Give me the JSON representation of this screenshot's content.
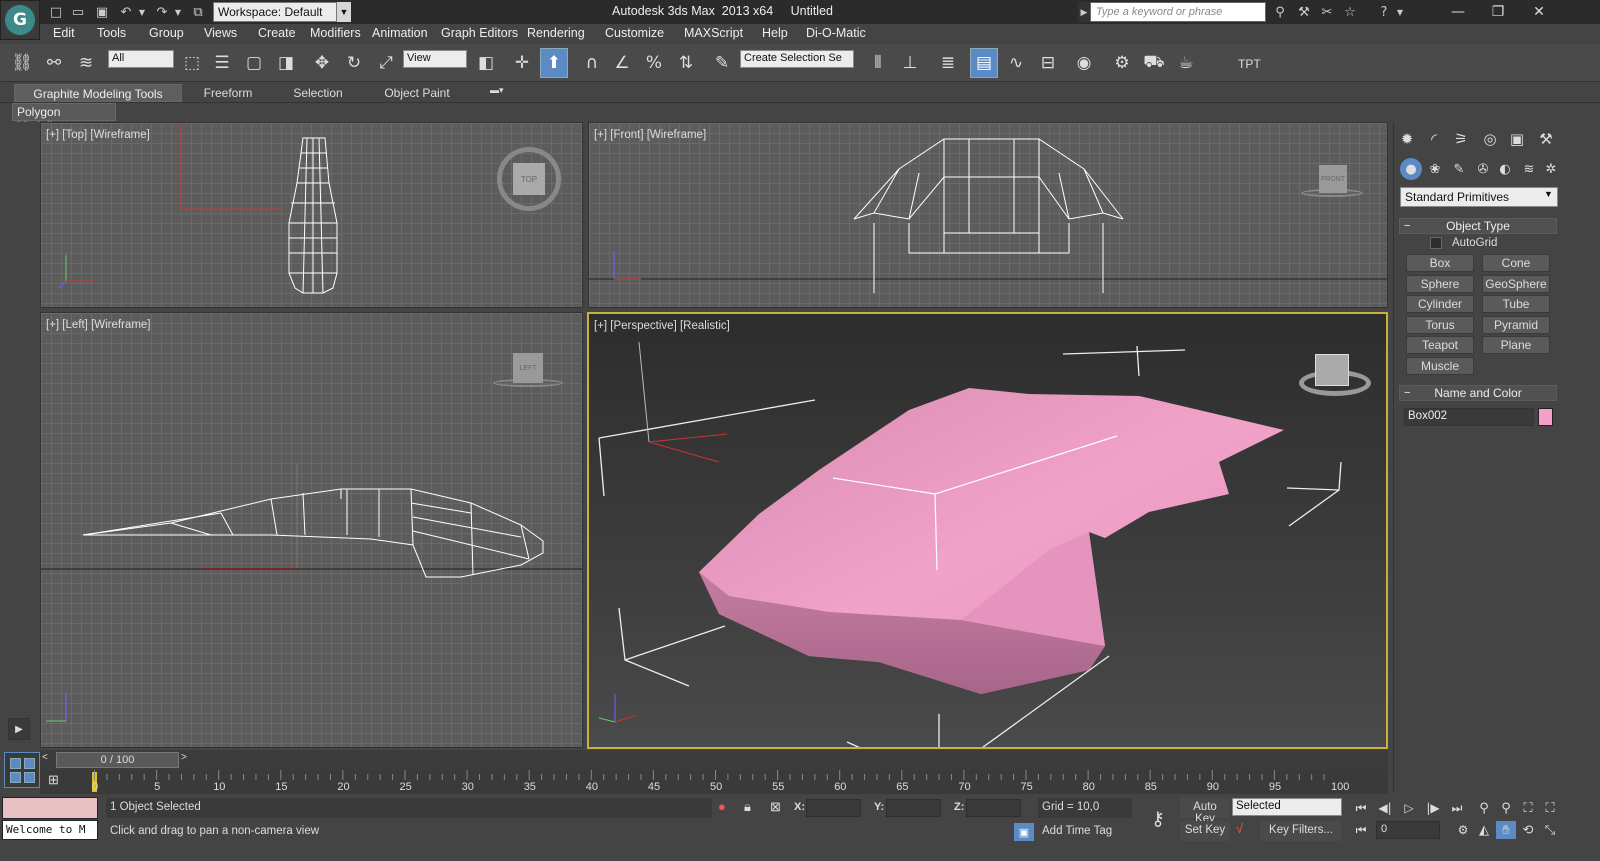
{
  "title_bar": {
    "workspace": "Workspace: Default",
    "app_title": "Autodesk 3ds Max  2013 x64",
    "document": "Untitled",
    "search_placeholder": "Type a keyword or phrase",
    "logo": "G"
  },
  "menu": [
    "Edit",
    "Tools",
    "Group",
    "Views",
    "Create",
    "Modifiers",
    "Animation",
    "Graph Editors",
    "Rendering",
    "Customize",
    "MAXScript",
    "Help",
    "Di-O-Matic"
  ],
  "toolbar": {
    "selection_filter": "All",
    "ref_coord": "View",
    "named_selection": "Create Selection Se",
    "tpt": "TPT"
  },
  "ribbon": {
    "tabs": [
      "Graphite Modeling Tools",
      "Freeform",
      "Selection",
      "Object Paint"
    ],
    "panel": "Polygon Modeling"
  },
  "viewports": {
    "top": {
      "label": "[+] [Top] [Wireframe]",
      "cube": "TOP"
    },
    "front": {
      "label": "[+] [Front] [Wireframe]",
      "cube": "FRONT"
    },
    "left": {
      "label": "[+] [Left] [Wireframe]",
      "cube": "LEFT"
    },
    "persp": {
      "label": "[+] [Perspective] [Realistic]"
    }
  },
  "command_panel": {
    "dropdown": "Standard Primitives",
    "object_type": {
      "title": "Object Type",
      "autogrid": "AutoGrid",
      "buttons": [
        "Box",
        "Cone",
        "Sphere",
        "GeoSphere",
        "Cylinder",
        "Tube",
        "Torus",
        "Pyramid",
        "Teapot",
        "Plane",
        "Muscle"
      ]
    },
    "name_color": {
      "title": "Name and Color",
      "name": "Box002",
      "color": "#f29fcc"
    }
  },
  "timeline": {
    "slider": "0 / 100",
    "ticks": [
      "0",
      "5",
      "10",
      "15",
      "20",
      "25",
      "30",
      "35",
      "40",
      "45",
      "50",
      "55",
      "60",
      "65",
      "70",
      "75",
      "80",
      "85",
      "90",
      "95",
      "100"
    ]
  },
  "status": {
    "listener": "Welcome to M",
    "selection": "1 Object Selected",
    "prompt": "Click and drag to pan a non-camera view",
    "x_label": "X:",
    "y_label": "Y:",
    "z_label": "Z:",
    "grid": "Grid = 10,0",
    "add_time_tag": "Add Time Tag",
    "auto_key": "Auto Key",
    "set_key": "Set Key",
    "key_mode": "Selected",
    "key_filters": "Key Filters...",
    "frame": "0"
  },
  "colors": {
    "accent": "#5b8ac4",
    "active_viewport": "#c8b23a",
    "object": "#f29fcc"
  }
}
